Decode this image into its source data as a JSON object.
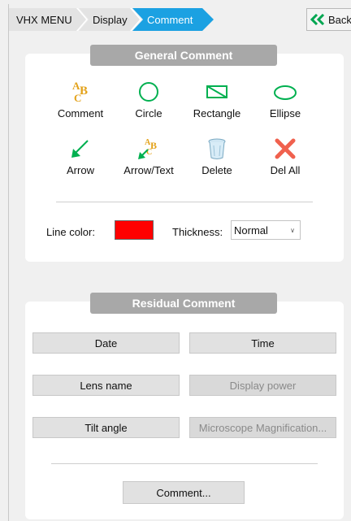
{
  "breadcrumb": {
    "items": [
      "VHX MENU",
      "Display",
      "Comment"
    ],
    "back_label": "Back"
  },
  "general": {
    "title": "General Comment",
    "tools": [
      {
        "label": "Comment",
        "icon": "abc-text-icon"
      },
      {
        "label": "Circle",
        "icon": "circle-icon"
      },
      {
        "label": "Rectangle",
        "icon": "rectangle-icon"
      },
      {
        "label": "Ellipse",
        "icon": "ellipse-icon"
      },
      {
        "label": "Arrow",
        "icon": "arrow-icon"
      },
      {
        "label": "Arrow/Text",
        "icon": "arrow-text-icon"
      },
      {
        "label": "Delete",
        "icon": "trash-icon"
      },
      {
        "label": "Del All",
        "icon": "x-icon"
      }
    ],
    "line_color_label": "Line color:",
    "line_color": "#ff0000",
    "thickness_label": "Thickness:",
    "thickness_value": "Normal"
  },
  "residual": {
    "title": "Residual Comment",
    "buttons": [
      {
        "label": "Date",
        "enabled": true
      },
      {
        "label": "Time",
        "enabled": true
      },
      {
        "label": "Lens name",
        "enabled": true
      },
      {
        "label": "Display power",
        "enabled": false
      },
      {
        "label": "Tilt angle",
        "enabled": true
      },
      {
        "label": "Microscope Magnification...",
        "enabled": false
      }
    ],
    "comment_button": "Comment..."
  },
  "colors": {
    "accent": "#1ba1e2",
    "green": "#00b050",
    "gold": "#e3a21a",
    "red": "#ff0000",
    "delete_x": "#f0614e"
  }
}
